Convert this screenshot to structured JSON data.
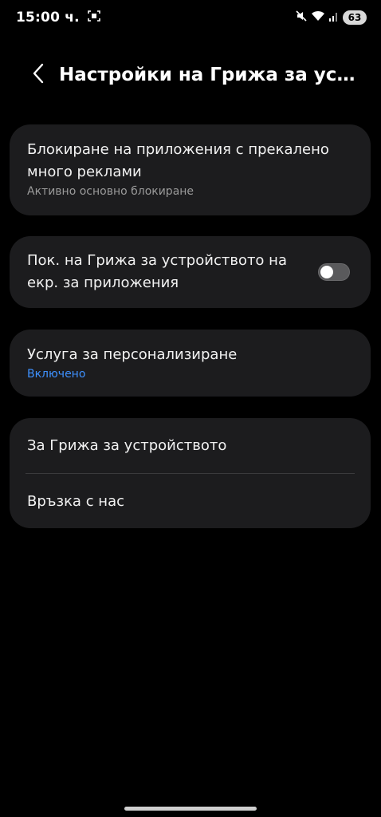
{
  "status": {
    "time": "15:00 ч.",
    "battery": "63"
  },
  "header": {
    "title": "Настройки на Грижа за ус..."
  },
  "card_blocking": {
    "title": "Блокиране на приложения с прекалено много реклами",
    "subtitle": "Активно основно блокиране"
  },
  "card_show": {
    "title": "Пок. на Грижа за устройството на екр. за приложения",
    "toggle_on": false
  },
  "card_personalization": {
    "title": "Услуга за персонализиране",
    "status": "Включено",
    "status_color": "#3e91ff"
  },
  "card_about": {
    "items": [
      {
        "label": "За Грижа за устройството"
      },
      {
        "label": "Връзка с нас"
      }
    ]
  }
}
